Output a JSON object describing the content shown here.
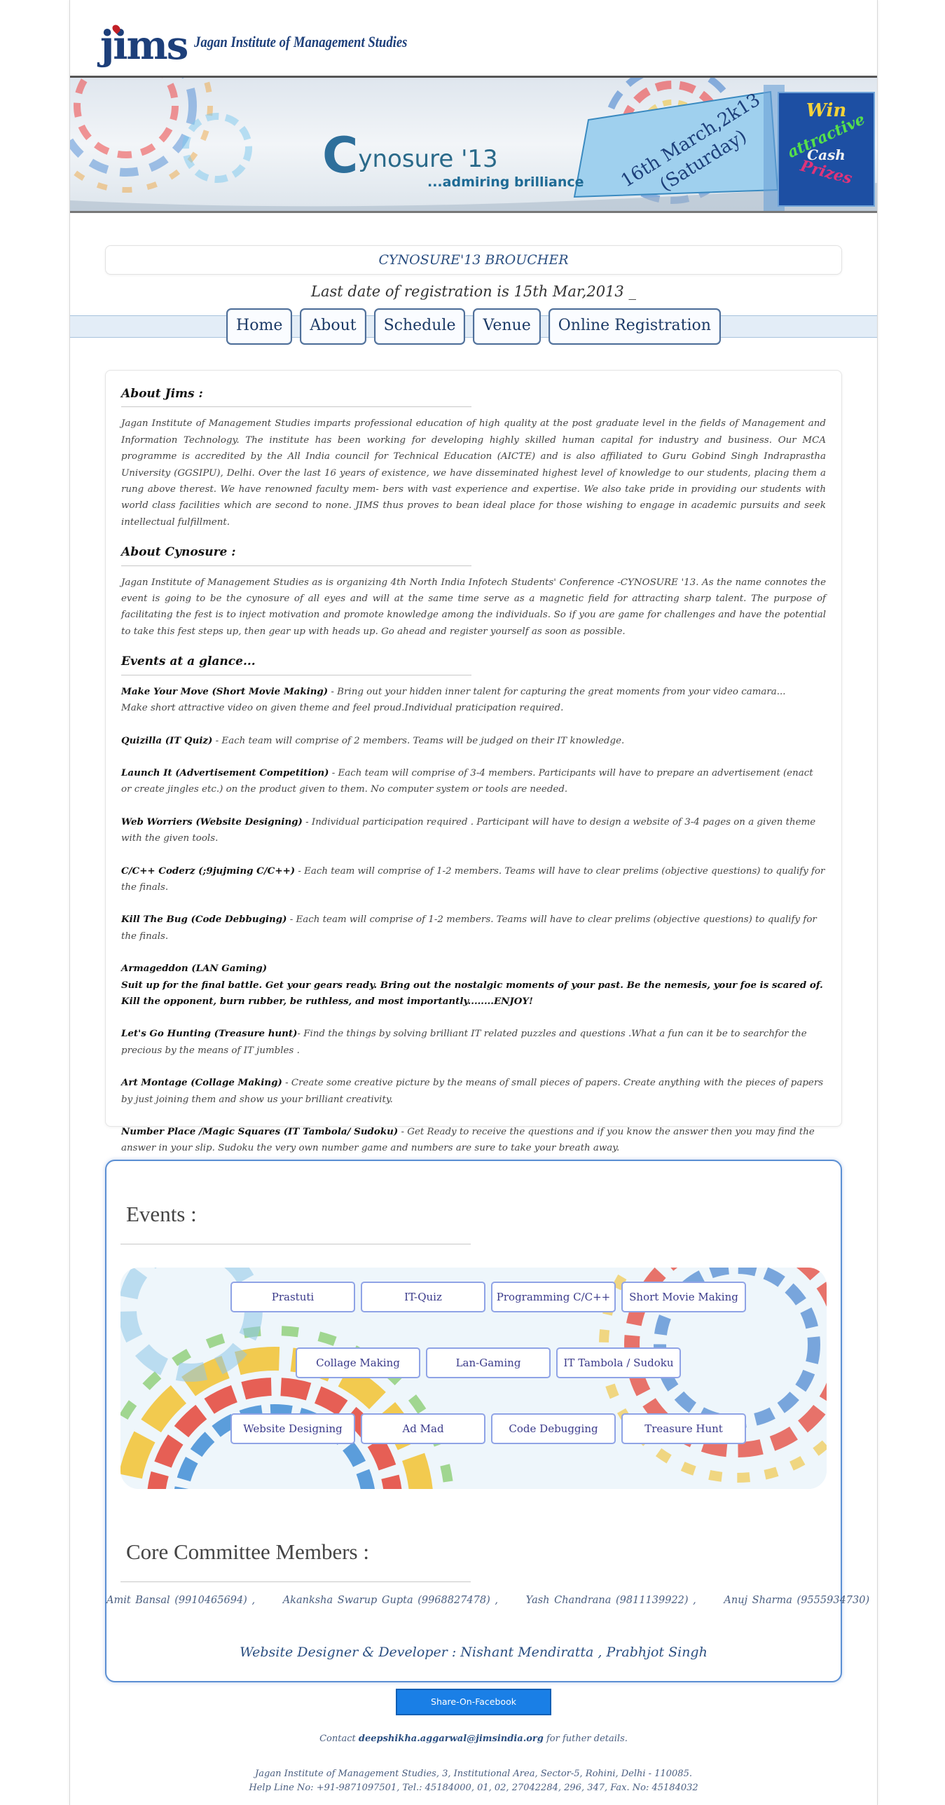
{
  "header": {
    "logo_mark": "jims",
    "logo_text": "Jagan Institute of Management Studies"
  },
  "banner": {
    "title_letter": "C",
    "title_rest": "ynosure '13",
    "subtitle": "...admiring brilliance",
    "date_line1": "16th March,2k13",
    "date_line2": "(Saturday)",
    "prize_win": "Win",
    "prize_attractive": "attractive",
    "prize_cash": "Cash",
    "prize_prizes": "Prizes"
  },
  "broucher_title": "CYNOSURE'13 BROUCHER",
  "last_date": "Last date of registration is 15th Mar,2013 _",
  "nav": {
    "items": [
      {
        "label": "Home"
      },
      {
        "label": "About"
      },
      {
        "label": "Schedule"
      },
      {
        "label": "Venue"
      },
      {
        "label": "Online Registration"
      }
    ]
  },
  "about": {
    "jims_heading": "About Jims :",
    "jims_text": "Jagan Institute of Management Studies imparts professional education of high quality at the post graduate level in the fields of Management and Information Technology. The institute has been working for developing highly skilled human capital for industry and business. Our MCA programme is accredited by the All India council for Technical Education (AICTE) and is also affiliated to Guru Gobind Singh Indraprastha University (GGSIPU), Delhi. Over the last 16 years of existence, we have disseminated highest level of knowledge to our students, placing them a rung above therest. We have renowned faculty mem- bers with vast experience and expertise. We also take pride in providing our students with world class facilities which are second to none. JIMS thus proves to bean ideal place for those wishing to engage in academic pursuits and seek intellectual fulfillment.",
    "cyno_heading": "About Cynosure :",
    "cyno_text": "Jagan Institute of Management Studies as is organizing 4th North India Infotech Students' Conference -CYNOSURE '13. As the name connotes the event is going to be the cynosure of all eyes and will at the same time serve as a magnetic field for attracting sharp talent. The purpose of facilitating the fest is to inject motivation and promote knowledge among the individuals. So if you are game for challenges and have the potential to take this fest steps up, then gear up with heads up. Go ahead and register yourself as soon as possible.",
    "glance_heading": "Events at a glance...",
    "events": [
      {
        "name": "Make Your Move (Short Movie Making)",
        "desc": " - Bring out your hidden inner talent for capturing the great moments from your video camara...",
        "desc2": "Make short attractive video on given theme and feel proud.Individual praticipation required."
      },
      {
        "name": "Quizilla (IT Quiz)",
        "desc": " - Each team will comprise of 2 members. Teams will be judged on their IT knowledge."
      },
      {
        "name": "Launch It (Advertisement Competition)",
        "desc": " - Each team will comprise of 3-4 members. Participants will have to prepare an advertisement (enact or create jingles etc.) on the product given to them. No computer system or tools are needed."
      },
      {
        "name": "Web Worriers (Website Designing)",
        "desc": " - Individual participation required . Participant will have to design a website of 3-4 pages on a given theme with the given tools."
      },
      {
        "name": "C/C++ Coderz (;9jujming C/C++)",
        "desc": " - Each team will comprise of 1-2 members. Teams will have to clear prelims (objective questions) to qualify for the finals."
      },
      {
        "name": "Kill The Bug (Code Debbuging)",
        "desc": " - Each team will comprise of 1-2 members. Teams will have to clear prelims (objective questions) to qualify for the finals."
      },
      {
        "name": "Armageddon (LAN Gaming)",
        "desc": "",
        "strong": "Suit up for the final battle. Get your gears ready. Bring out the nostalgic moments of your past. Be the nemesis, your foe is scared of. Kill the opponent, burn rubber, be ruthless, and most importantly........ENJOY!"
      },
      {
        "name": "Let's Go Hunting (Treasure hunt)",
        "desc": "- Find the things by solving brilliant IT related puzzles and questions .What a fun can it be to searchfor the precious by the means of IT jumbles ."
      },
      {
        "name": "Art Montage (Collage Making)",
        "desc": " - Create some creative picture by the means of small pieces of papers. Create anything with the pieces of papers by just joining them and show us your brilliant creativity."
      },
      {
        "name": "Number Place /Magic Squares (IT Tambola/ Sudoku)",
        "desc": " - Get Ready to receive the questions and if you know the answer then you may find the answer in your slip. Sudoku the very own number game and numbers are sure to take your breath away."
      }
    ]
  },
  "events_section": {
    "heading": "Events :",
    "buttons_row1": [
      "Prastuti",
      "IT-Quiz",
      "Programming C/C++",
      "Short Movie Making"
    ],
    "buttons_row2": [
      "Collage Making",
      "Lan-Gaming",
      "IT Tambola / Sudoku"
    ],
    "buttons_row3": [
      "Website Designing",
      "Ad Mad",
      "Code Debugging",
      "Treasure Hunt"
    ]
  },
  "committee": {
    "heading": "Core Committee Members :",
    "members": "Amit Bansal (9910465694) ,      Akanksha Swarup Gupta (9968827478) ,      Yash Chandrana (9811139922) ,      Anuj Sharma (9555934730)",
    "designer": "Website Designer & Developer : Nishant Mendiratta , Prabhjot Singh"
  },
  "share_label": "Share-On-Facebook",
  "contact": {
    "prefix": "Contact ",
    "email": "deepshikha.aggarwal@jimsindia.org",
    "suffix": " for futher details."
  },
  "footer": {
    "line1": "Jagan Institute of Management Studies, 3, Institutional Area, Sector-5, Rohini, Delhi - 110085.",
    "line2": "Help Line No: +91-9871097501, Tel.: 45184000, 01, 02, 27042284, 296, 347, Fax. No: 45184032"
  }
}
